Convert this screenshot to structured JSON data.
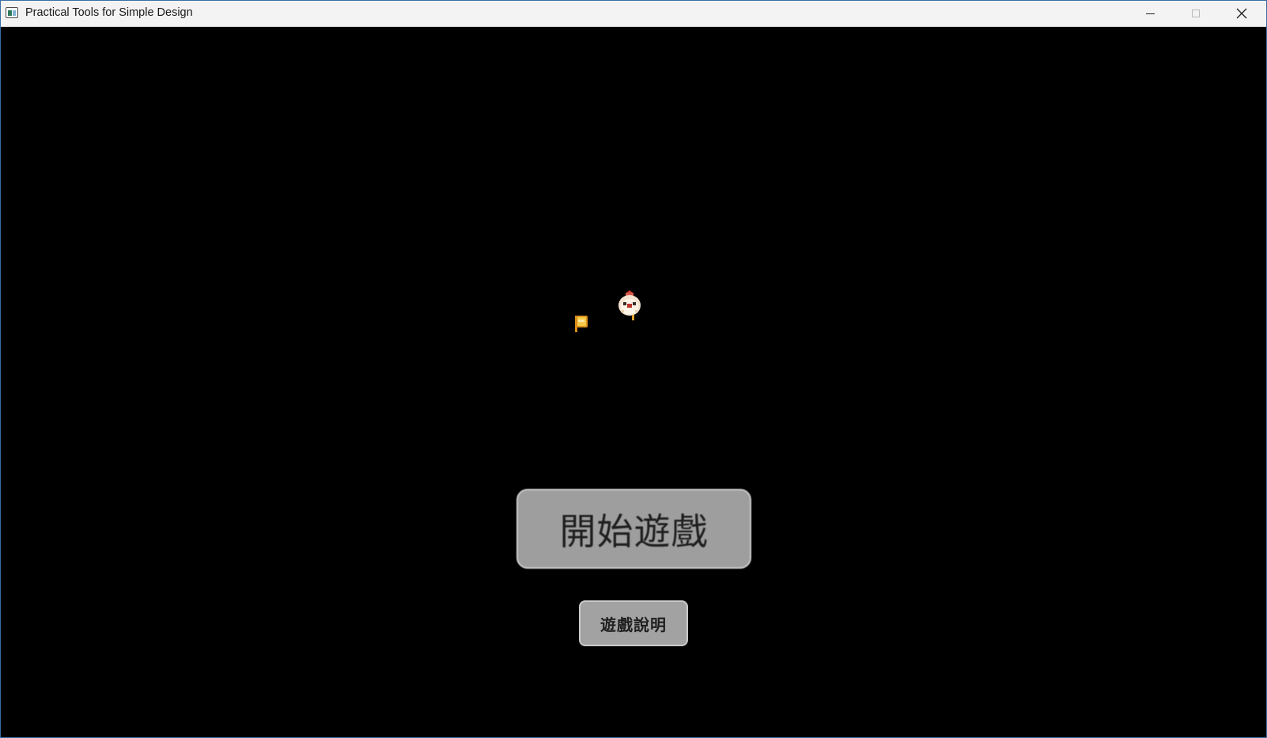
{
  "window": {
    "title": "Practical Tools for Simple Design",
    "controls": {
      "minimize": "minimize-icon",
      "maximize": "maximize-icon",
      "close": "close-icon"
    }
  },
  "game": {
    "background": "#000000",
    "sprites": [
      {
        "name": "flag-sprite",
        "color": "#f2b534"
      },
      {
        "name": "chicken-sprite",
        "color": "#f1dcc2"
      }
    ],
    "menu": {
      "start_label": "開始遊戲",
      "help_label": "遊戲說明"
    }
  }
}
